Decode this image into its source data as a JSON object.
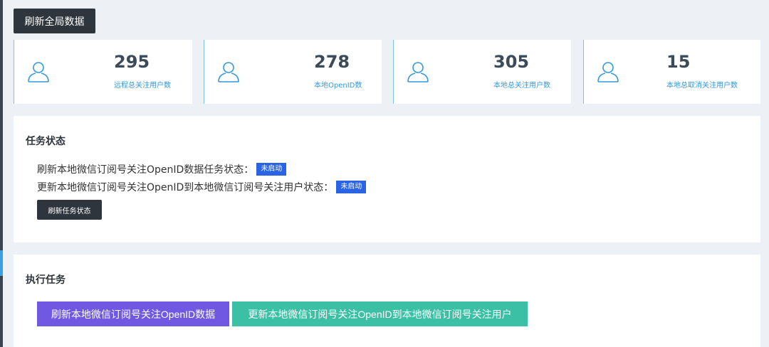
{
  "header": {
    "refresh_all_label": "刷新全局数据"
  },
  "stats": [
    {
      "value": "295",
      "label": "远程总关注用户数",
      "icon": "user-icon"
    },
    {
      "value": "278",
      "label": "本地OpenID数",
      "icon": "user-icon"
    },
    {
      "value": "305",
      "label": "本地总关注用户数",
      "icon": "user-icon"
    },
    {
      "value": "15",
      "label": "本地总取消关注用户数",
      "icon": "user-icon"
    }
  ],
  "task_status": {
    "title": "任务状态",
    "items": [
      {
        "text": "刷新本地微信订阅号关注OpenID数据任务状态：",
        "badge": "未启动"
      },
      {
        "text": "更新本地微信订阅号关注OpenID到本地微信订阅号关注用户状态：",
        "badge": "未启动"
      }
    ],
    "refresh_button": "刷新任务状态"
  },
  "execute": {
    "title": "执行任务",
    "buttons": [
      {
        "label": "刷新本地微信订阅号关注OpenID数据",
        "color": "#7158e2"
      },
      {
        "label": "更新本地微信订阅号关注OpenID到本地微信订阅号关注用户",
        "color": "#3bbfa5"
      }
    ]
  },
  "colors": {
    "accent": "#3598dc",
    "badge": "#2a64e4",
    "dark_button": "#2f353d"
  }
}
